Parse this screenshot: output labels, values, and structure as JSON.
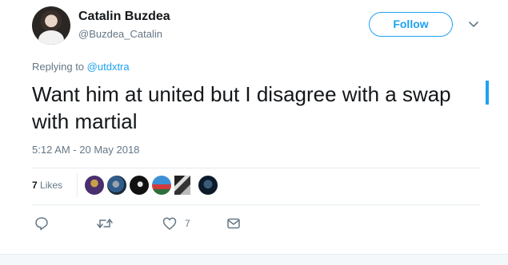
{
  "author": {
    "display_name": "Catalin Buzdea",
    "handle": "@Buzdea_Catalin"
  },
  "follow_label": "Follow",
  "reply": {
    "prefix": "Replying to",
    "mention": "@utdxtra"
  },
  "tweet_text": "Want him at united but I disagree with a swap with martial",
  "timestamp": "5:12 AM - 20 May 2018",
  "likes": {
    "count": "7",
    "label": "Likes",
    "likers": [
      "liker-avatar-1",
      "liker-avatar-2",
      "liker-avatar-3",
      "liker-avatar-4",
      "liker-avatar-5",
      "liker-avatar-6"
    ]
  },
  "actions": {
    "like_count": "7"
  },
  "colors": {
    "accent": "#1da1f2",
    "muted": "#657786",
    "text": "#14171a",
    "border": "#e6ecf0"
  },
  "icons": [
    "reply-icon",
    "retweet-icon",
    "like-icon",
    "direct-message-icon",
    "chevron-down-icon"
  ]
}
